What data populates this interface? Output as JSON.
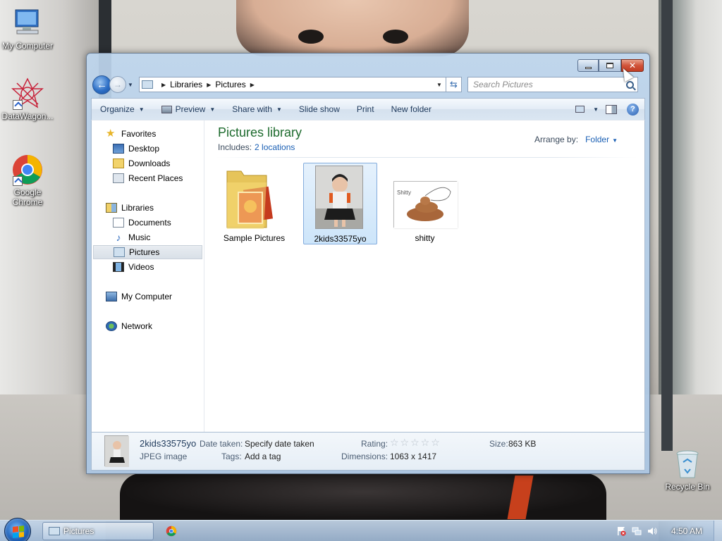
{
  "desktop": {
    "icons": [
      {
        "label": "My Computer"
      },
      {
        "label": "DataWagon..."
      },
      {
        "label": "Google Chrome"
      },
      {
        "label": "Recycle Bin"
      }
    ]
  },
  "window": {
    "address": {
      "crumbs": [
        "Libraries",
        "Pictures"
      ]
    },
    "search": {
      "placeholder": "Search Pictures"
    },
    "toolbar": {
      "organize": "Organize",
      "preview": "Preview",
      "share_with": "Share with",
      "slide_show": "Slide show",
      "print": "Print",
      "new_folder": "New folder"
    },
    "nav": {
      "favorites": "Favorites",
      "desktop": "Desktop",
      "downloads": "Downloads",
      "recent_places": "Recent Places",
      "libraries": "Libraries",
      "documents": "Documents",
      "music": "Music",
      "pictures": "Pictures",
      "videos": "Videos",
      "my_computer": "My Computer",
      "network": "Network"
    },
    "library": {
      "title": "Pictures library",
      "includes_label": "Includes:",
      "locations": "2 locations",
      "arrange_label": "Arrange by:",
      "arrange_value": "Folder"
    },
    "items": [
      {
        "label": "Sample Pictures"
      },
      {
        "label": "2kids33575yo"
      },
      {
        "label": "shitty"
      }
    ],
    "details": {
      "name": "2kids33575yo",
      "type": "JPEG image",
      "date_taken_label": "Date taken:",
      "date_taken": "Specify date taken",
      "tags_label": "Tags:",
      "tags": "Add a tag",
      "rating_label": "Rating:",
      "rating_stars": "☆☆☆☆☆",
      "dimensions_label": "Dimensions:",
      "dimensions": "1063 x 1417",
      "size_label": "Size:",
      "size": "863 KB"
    }
  },
  "taskbar": {
    "window_title": "Pictures",
    "clock": "4:50 AM"
  },
  "colors": {
    "library_title": "#1e6b2e",
    "link": "#1a5fb4",
    "close_button": "#c23b22"
  }
}
